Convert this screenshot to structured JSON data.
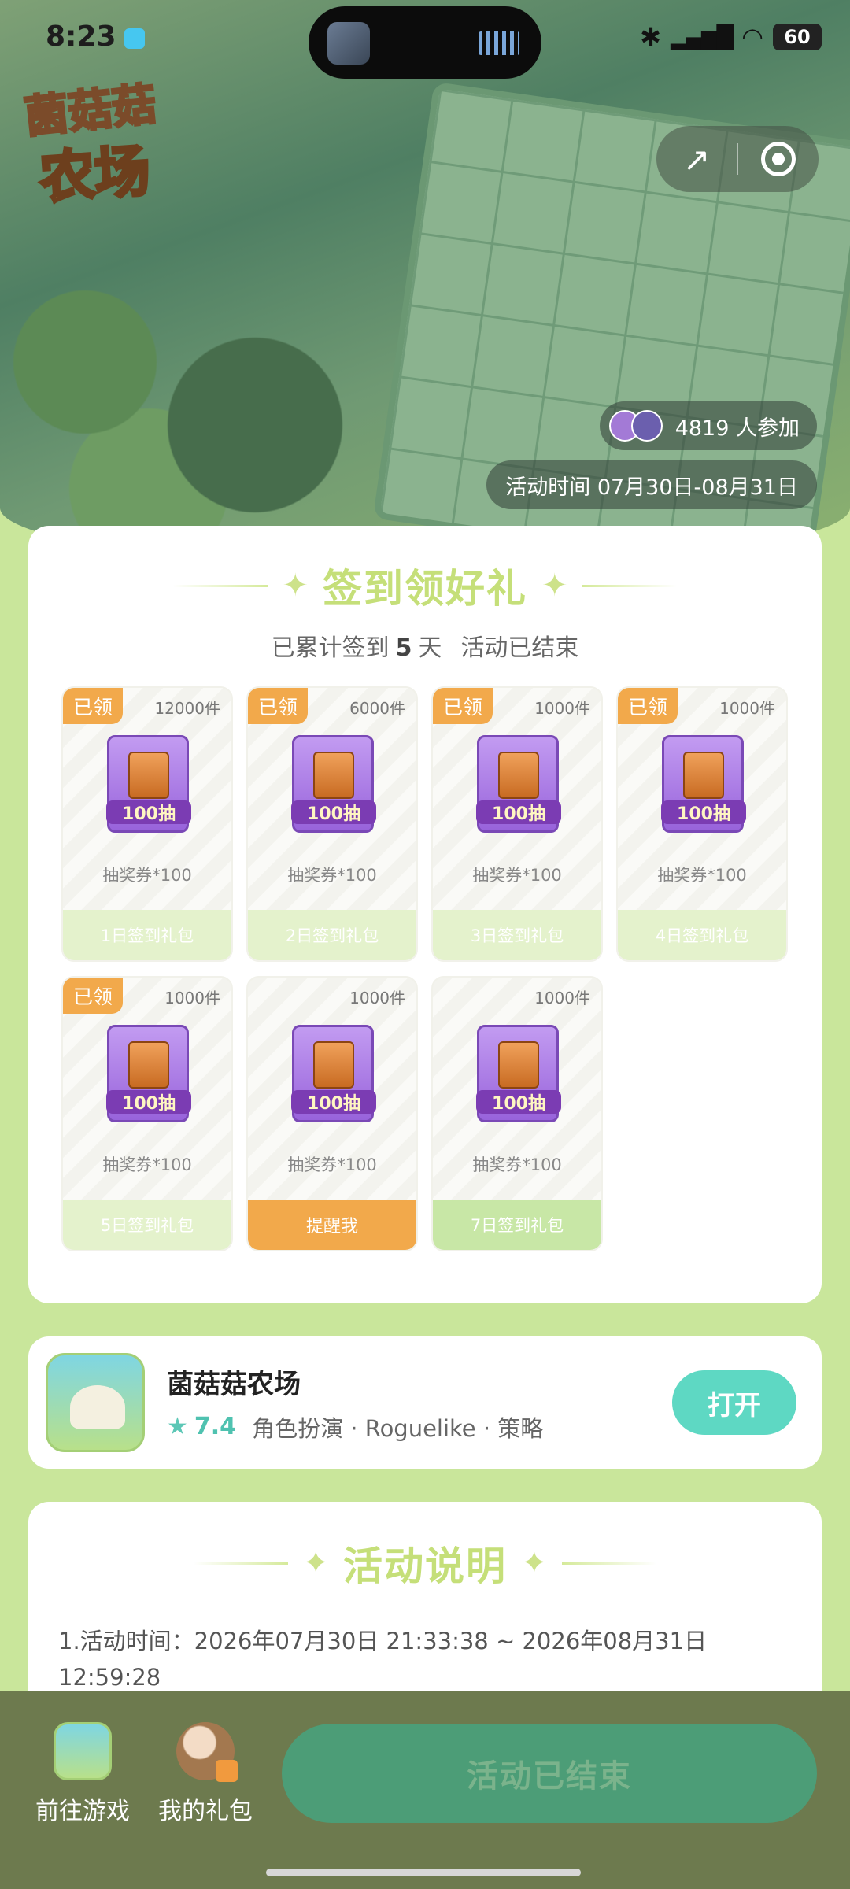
{
  "status_bar": {
    "time": "8:23",
    "battery": "60",
    "network": "5G"
  },
  "hero": {
    "logo_line1": "菌菇菇",
    "logo_line2": "农场",
    "participants": "4819 人参加",
    "period": "活动时间 07月30日-08月31日"
  },
  "signin": {
    "title": "签到领好礼",
    "subtitle_prefix": "已累计签到",
    "days": "5",
    "subtitle_suffix": "天",
    "status": "活动已结束",
    "gifts": [
      {
        "claimed": "已领",
        "stock": "12000件",
        "voucher": "100抽",
        "desc": "抽奖券*100",
        "button": "1日签到礼包"
      },
      {
        "claimed": "已领",
        "stock": "6000件",
        "voucher": "100抽",
        "desc": "抽奖券*100",
        "button": "2日签到礼包"
      },
      {
        "claimed": "已领",
        "stock": "1000件",
        "voucher": "100抽",
        "desc": "抽奖券*100",
        "button": "3日签到礼包"
      },
      {
        "claimed": "已领",
        "stock": "1000件",
        "voucher": "100抽",
        "desc": "抽奖券*100",
        "button": "4日签到礼包"
      },
      {
        "claimed": "已领",
        "stock": "1000件",
        "voucher": "100抽",
        "desc": "抽奖券*100",
        "button": "5日签到礼包"
      },
      {
        "claimed": "",
        "stock": "1000件",
        "voucher": "100抽",
        "desc": "抽奖券*100",
        "button": "提醒我"
      },
      {
        "claimed": "",
        "stock": "1000件",
        "voucher": "100抽",
        "desc": "抽奖券*100",
        "button": "7日签到礼包"
      }
    ]
  },
  "app": {
    "name": "菌菇菇农场",
    "rating": "7.4",
    "tags": "角色扮演 · Roguelike · 策略",
    "open_label": "打开"
  },
  "rules": {
    "title": "活动说明",
    "line1": "1.活动时间：2026年07月30日 21:33:38 ~ 2026年08月31日 12:59:28"
  },
  "bottom_bar": {
    "go_game": "前往游戏",
    "my_gifts": "我的礼包",
    "cta": "活动已结束"
  },
  "colors": {
    "accent_green": "#c5df79",
    "orange": "#f2a94b",
    "teal": "#5ed8c3",
    "bottom_bar": "#6d7a4e"
  }
}
